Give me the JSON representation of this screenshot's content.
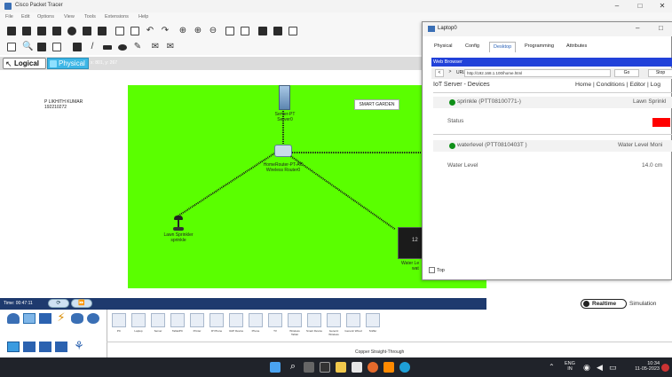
{
  "app": {
    "title": "Cisco Packet Tracer",
    "window_buttons": [
      "–",
      "□",
      "✕"
    ]
  },
  "menu": [
    "File",
    "Edit",
    "Options",
    "View",
    "Tools",
    "Extensions",
    "Help"
  ],
  "viewbar": {
    "logical_label": "Logical",
    "physical_label": "Physical",
    "coords": "x: 801, y: 267"
  },
  "workspace": {
    "note_lines": [
      "P LIKHITH KUMAR",
      "192210272"
    ],
    "garden_label": "SMART GARDEN",
    "devices": {
      "server": [
        "Server-PT",
        "Server0"
      ],
      "router": [
        "HomeRouter-PT-AC",
        "Wireless Router0"
      ],
      "sprinkler": [
        "Lawn Sprinkler",
        "sprinkle"
      ],
      "laptop": [
        "Water Le",
        "wat"
      ],
      "laptop_screen_num": "12"
    }
  },
  "dialog": {
    "title": "Laptop0",
    "buttons": [
      "–",
      "□"
    ],
    "tabs": [
      "Physical",
      "Config",
      "Desktop",
      "Programming",
      "Attributes"
    ],
    "active_tab": "Desktop",
    "web_browser_label": "Web Browser",
    "nav": {
      "back": "<",
      "forward": ">",
      "url_label": "URL",
      "url": "http://192.168.1.100/home.html",
      "go": "Go",
      "stop": "Stop"
    },
    "page": {
      "title": "IoT Server - Devices",
      "links": "Home | Conditions | Editor | Log",
      "devices": [
        {
          "name": "sprinkle (PTT08100771-)",
          "type": "Lawn Sprinkl",
          "prop_label": "Status",
          "status_color": "#ff0000"
        },
        {
          "name": "waterlevel (PTT0810403T )",
          "type": "Water Level Moni",
          "prop_label": "Water Level",
          "value": "14.0 cm"
        }
      ]
    },
    "top_label": "Top"
  },
  "timebar": {
    "time": "Time: 00:47:11",
    "realtime_label": "Realtime",
    "simulation_label": "Simulation"
  },
  "palette": {
    "device_labels": [
      "PC",
      "Laptop",
      "Server",
      "TabletPC",
      "Printer",
      "IP Phone",
      "VoIP Device",
      "Phone",
      "TV",
      "Wireless Tablet",
      "Smart Device",
      "Generic Wireless",
      "Generic Wired",
      "Sniffer"
    ],
    "cable_label": "Copper Straight-Through"
  },
  "taskbar": {
    "lang": "ENG",
    "region": "IN",
    "time": "10:34",
    "date": "11-05-2023"
  }
}
